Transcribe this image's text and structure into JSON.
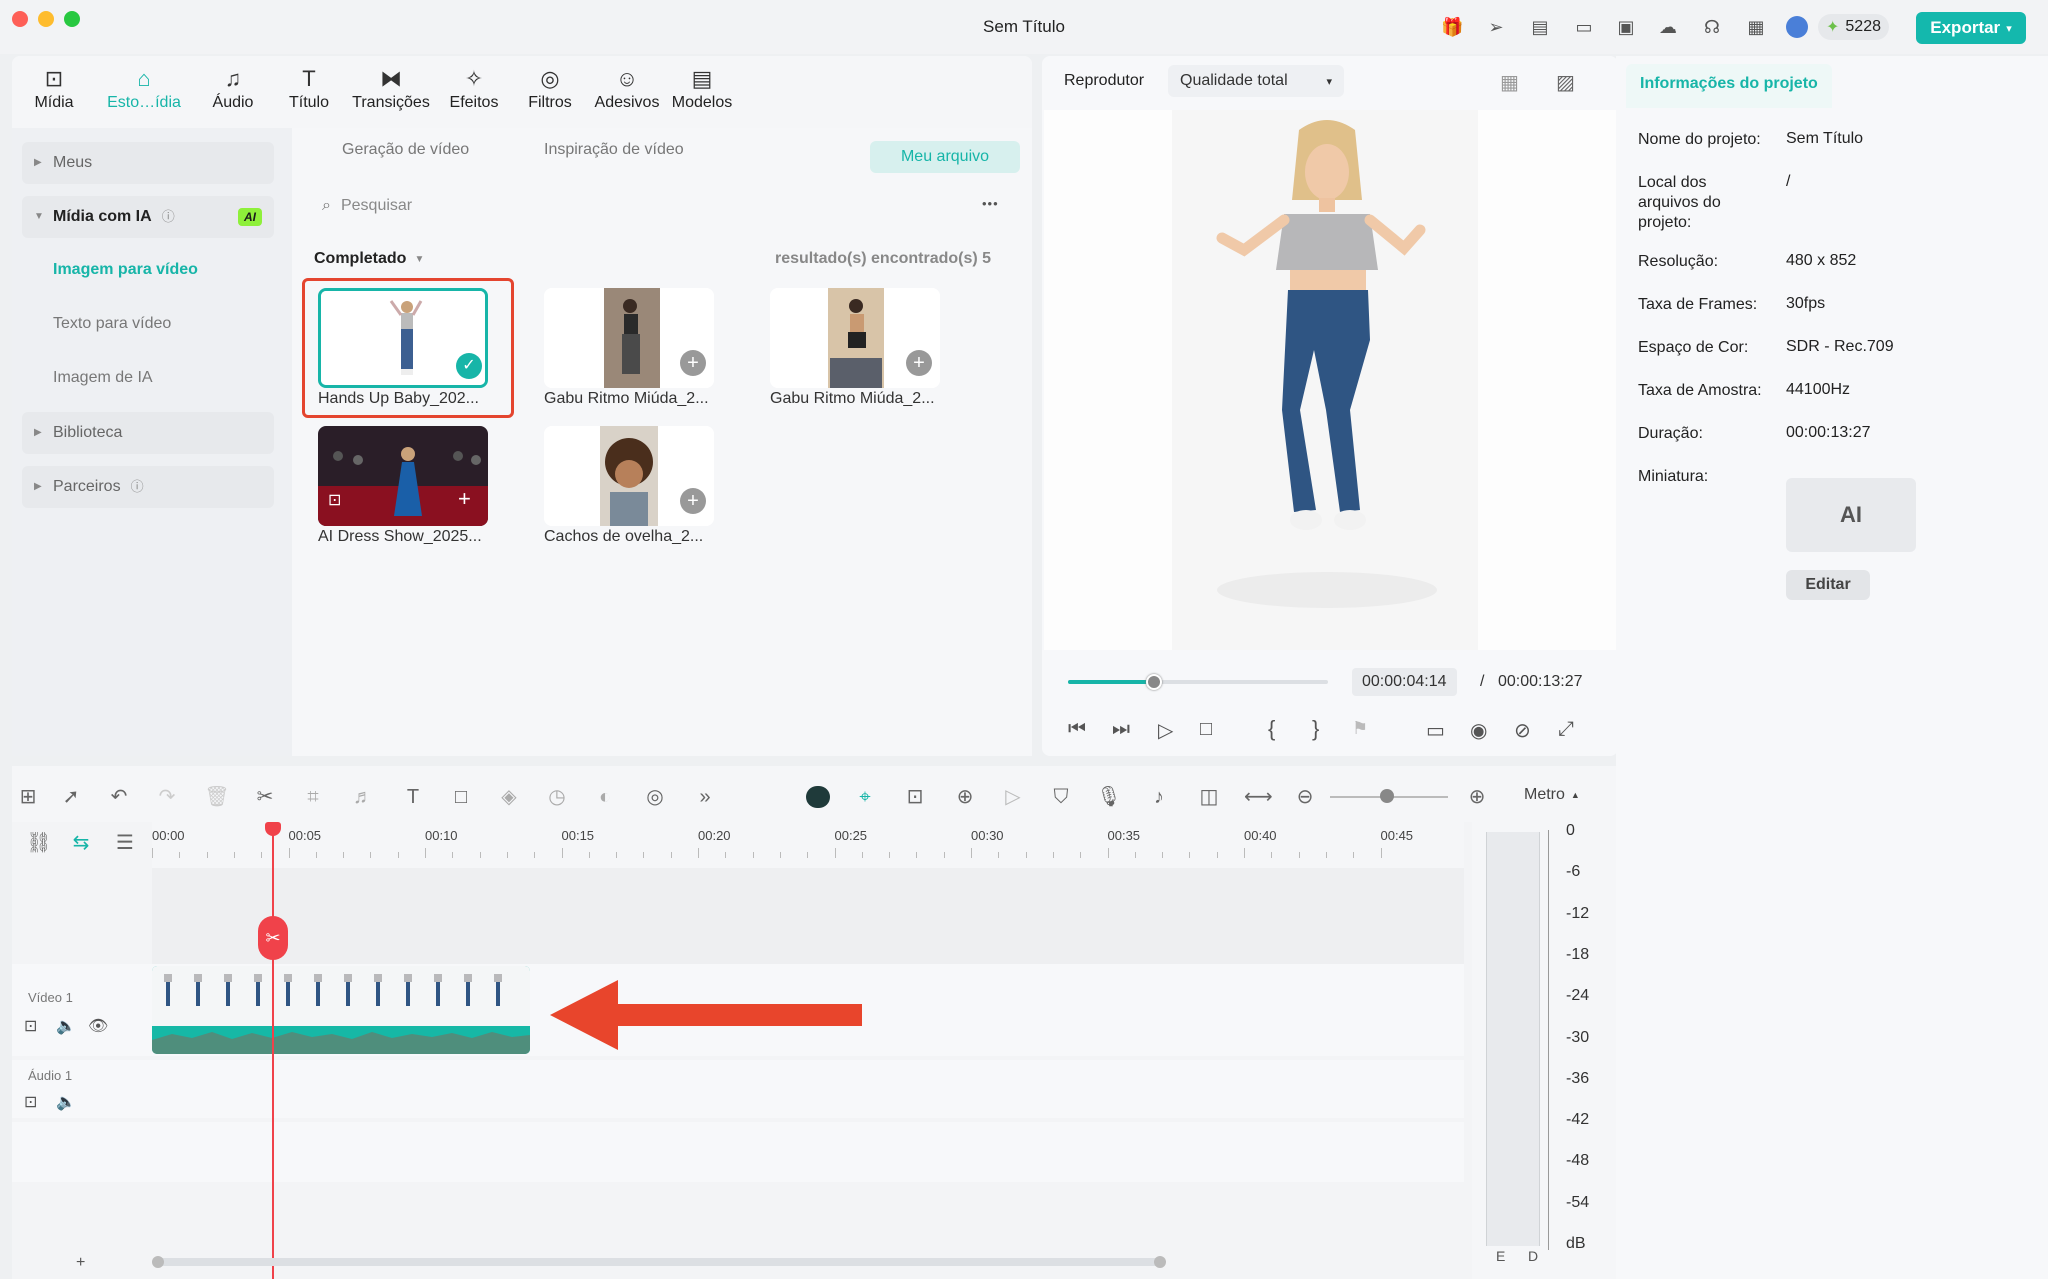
{
  "window": {
    "title": "Sem Título"
  },
  "titlebar": {
    "credits": "5228",
    "export_label": "Exportar"
  },
  "toolbar": {
    "tabs": [
      {
        "label": "Mídia",
        "icon": "media-icon"
      },
      {
        "label": "Esto…ídia",
        "icon": "stock-icon"
      },
      {
        "label": "Áudio",
        "icon": "music-icon"
      },
      {
        "label": "Título",
        "icon": "title-icon"
      },
      {
        "label": "Transições",
        "icon": "transition-icon"
      },
      {
        "label": "Efeitos",
        "icon": "effects-icon"
      },
      {
        "label": "Filtros",
        "icon": "filters-icon"
      },
      {
        "label": "Adesivos",
        "icon": "sticker-icon"
      },
      {
        "label": "Modelos",
        "icon": "templates-icon"
      }
    ]
  },
  "sidebar": {
    "meus": "Meus",
    "midia_ia": "Mídia com IA",
    "ai_badge": "AI",
    "imagem_para_video": "Imagem para vídeo",
    "texto_para_video": "Texto para vídeo",
    "imagem_de_ia": "Imagem de IA",
    "biblioteca": "Biblioteca",
    "parceiros": "Parceiros"
  },
  "content": {
    "tab_geracao": "Geração de vídeo",
    "tab_inspiracao": "Inspiração de vídeo",
    "tab_meu_arquivo": "Meu arquivo",
    "search_placeholder": "Pesquisar",
    "more": "•••",
    "filter": "Completado",
    "results": "resultado(s) encontrado(s) 5",
    "items": [
      {
        "label": "Hands Up Baby_202..."
      },
      {
        "label": "Gabu Ritmo Miúda_2..."
      },
      {
        "label": "Gabu Ritmo Miúda_2..."
      },
      {
        "label": "AI Dress Show_2025..."
      },
      {
        "label": "Cachos de ovelha_2..."
      }
    ]
  },
  "player": {
    "label": "Reprodutor",
    "quality": "Qualidade total",
    "current_time": "00:00:04:14",
    "separator": "/",
    "total_time": "00:00:13:27",
    "progress": 0.33
  },
  "project_info": {
    "title": "Informações do projeto",
    "rows": [
      {
        "label": "Nome do projeto:",
        "value": "Sem Título"
      },
      {
        "label": "Local dos arquivos do projeto:",
        "value": "/"
      },
      {
        "label": "Resolução:",
        "value": "480 x 852"
      },
      {
        "label": "Taxa de Frames:",
        "value": "30fps"
      },
      {
        "label": "Espaço de Cor:",
        "value": "SDR - Rec.709"
      },
      {
        "label": "Taxa de Amostra:",
        "value": "44100Hz"
      },
      {
        "label": "Duração:",
        "value": "00:00:13:27"
      },
      {
        "label": "Miniatura:",
        "value": ""
      }
    ],
    "thumb_text": "AI",
    "edit_label": "Editar"
  },
  "timeline": {
    "meter_label": "Metro",
    "ruler": [
      "00:00",
      "00:05",
      "00:10",
      "00:15",
      "00:20",
      "00:25",
      "00:30",
      "00:35",
      "00:40",
      "00:45"
    ],
    "video_track": "Vídeo 1",
    "audio_track": "Áudio 1",
    "add": "+",
    "db_scale": [
      "0",
      "-6",
      "-12",
      "-18",
      "-24",
      "-30",
      "-36",
      "-42",
      "-48",
      "-54",
      "dB"
    ],
    "channels": [
      "E",
      "D"
    ]
  },
  "colors": {
    "accent": "#17b5a8",
    "playhead": "#f0424a",
    "highlight_box": "#e4452f",
    "arrow": "#e8452c"
  }
}
